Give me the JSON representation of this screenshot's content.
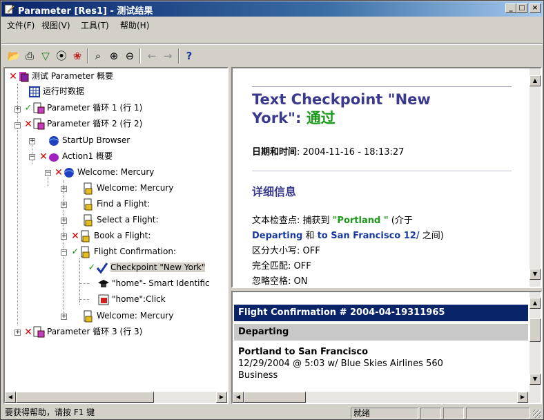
{
  "window": {
    "title": "Parameter [Res1] - 测试结果",
    "min_label": "_",
    "max_label": "□",
    "close_label": "×"
  },
  "menu": [
    "文件(F)",
    "视图(V)",
    "工具(T)",
    "帮助(H)"
  ],
  "tree": {
    "root": "测试 Parameter 概要",
    "runtime": "运行时数据",
    "iter1": "Parameter 循环 1 (行 1)",
    "iter2": "Parameter 循环 2 (行 2)",
    "startup": "StartUp Browser",
    "action1": "Action1 概要",
    "welcome1": "Welcome: Mercury",
    "welcome2": "Welcome: Mercury",
    "find": "Find a Flight:",
    "select": "Select a Flight:",
    "book": "Book a Flight:",
    "confirm": "Flight Confirmation:",
    "checkpoint": "Checkpoint \"New York\"",
    "home_smart": "\"home\"- Smart Identific",
    "home_click": "\"home\":Click",
    "welcome3": "Welcome: Mercury",
    "iter3": "Parameter 循环 3 (行 3)"
  },
  "details": {
    "heading_line1": "Text Checkpoint \"New",
    "heading_line2": "York\": ",
    "heading_status": "通过",
    "datetime_label": "日期和时间",
    "datetime_value": ": 2004-11-16 - 18:13:27",
    "section": "详细信息",
    "line1_a": "文本检查点: 捕获到 ",
    "line1_b": "\"Portland \"",
    "line1_c": " (介于",
    "line2_a": "Departing",
    "line2_b": " 和 ",
    "line2_c": " to San Francisco 12/",
    "line2_d": " 之间)",
    "case": "区分大小写: OFF",
    "exact": "完全匹配: OFF",
    "spaces": "忽略空格: ON"
  },
  "snapshot": {
    "header": "Flight Confirmation # 2004-04-19311965",
    "subheader": "Departing",
    "route": "Portland to San Francisco",
    "flight": "12/29/2004 @ 5:03 w/ Blue Skies Airlines 560",
    "class": "Business"
  },
  "status": {
    "help": "要获得帮助，请按 F1 键",
    "ready": "就绪"
  },
  "colors": {
    "accent": "#3a3a8c",
    "pass": "#1a9a1a",
    "fail": "#d00000",
    "banner": "#0a246a"
  }
}
